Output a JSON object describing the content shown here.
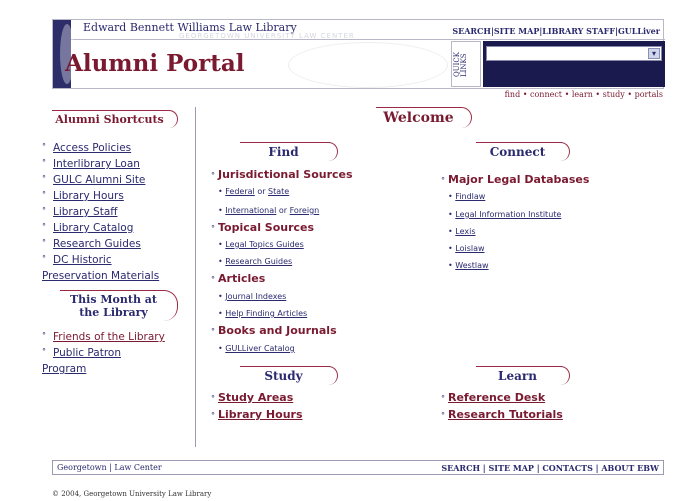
{
  "header": {
    "library_name": "Edward Bennett Williams Law Library",
    "subtitle": "GEORGETOWN UNIVERSITY LAW CENTER",
    "top_links": [
      "SEARCH",
      "SITE MAP",
      "LIBRARY STAFF",
      "GULLiver"
    ],
    "portal_title": "Alumni Portal",
    "quick_links_label": "QUICK LINKS",
    "quick_links_value": "",
    "tagline": "find • connect • learn • study • portals"
  },
  "sidebar": {
    "shortcuts_title": "Alumni Shortcuts",
    "shortcuts": [
      "Access Policies",
      "Interlibrary Loan",
      "GULC Alumni Site",
      "Library Hours",
      "Library Staff",
      "Library Catalog",
      "Research Guides",
      "DC Historic",
      "Preservation Materials"
    ],
    "month_title": "This Month at the Library",
    "month_items": [
      "Friends of the Library",
      "Public Patron",
      "Program"
    ]
  },
  "main": {
    "welcome": "Welcome",
    "find": {
      "title": "Find",
      "jurisdictional": "Jurisdictional Sources",
      "federal": "Federal",
      "or1": "or",
      "state": "State",
      "international": "International",
      "or2": "or",
      "foreign": "Foreign",
      "topical": "Topical Sources",
      "legal_topics": "Legal Topics Guides",
      "research_guides": "Research Guides",
      "articles": "Articles",
      "journal_indexes": "Journal Indexes",
      "help_articles": "Help Finding Articles",
      "books": "Books and Journals",
      "gulliver": "GULLiver Catalog"
    },
    "connect": {
      "title": "Connect",
      "major": "Major Legal Databases",
      "items": [
        "Findlaw",
        "Legal Information Institute",
        "Lexis",
        "Loislaw",
        "Westlaw"
      ]
    },
    "study": {
      "title": "Study",
      "items": [
        "Study Areas",
        "Library Hours"
      ]
    },
    "learn": {
      "title": "Learn",
      "items": [
        "Reference Desk",
        "Research Tutorials"
      ]
    }
  },
  "footer": {
    "left": "Georgetown | Law Center",
    "right": "SEARCH | SITE MAP | CONTACTS | ABOUT EBW",
    "copyright": "© 2004, Georgetown University Law Library"
  }
}
